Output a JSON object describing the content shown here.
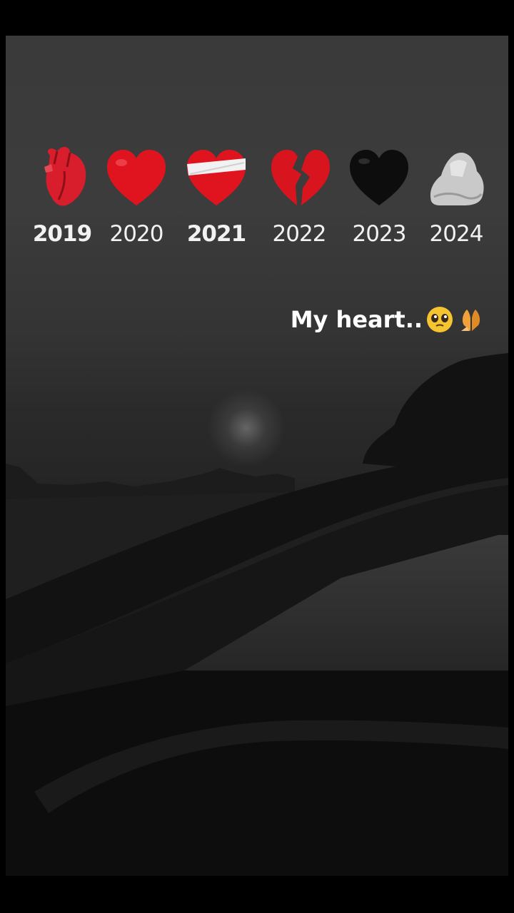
{
  "caption": {
    "text": "My heart..",
    "emojis": [
      "pleading-face-icon",
      "folded-hands-icon"
    ]
  },
  "timeline": [
    {
      "year": "2019",
      "icon": "anatomical-heart-icon",
      "bold": true
    },
    {
      "year": "2020",
      "icon": "red-heart-icon",
      "bold": false
    },
    {
      "year": "2021",
      "icon": "bandaged-heart-icon",
      "bold": true
    },
    {
      "year": "2022",
      "icon": "broken-heart-icon",
      "bold": false
    },
    {
      "year": "2023",
      "icon": "black-heart-icon",
      "bold": false
    },
    {
      "year": "2024",
      "icon": "rock-icon",
      "bold": false
    }
  ]
}
